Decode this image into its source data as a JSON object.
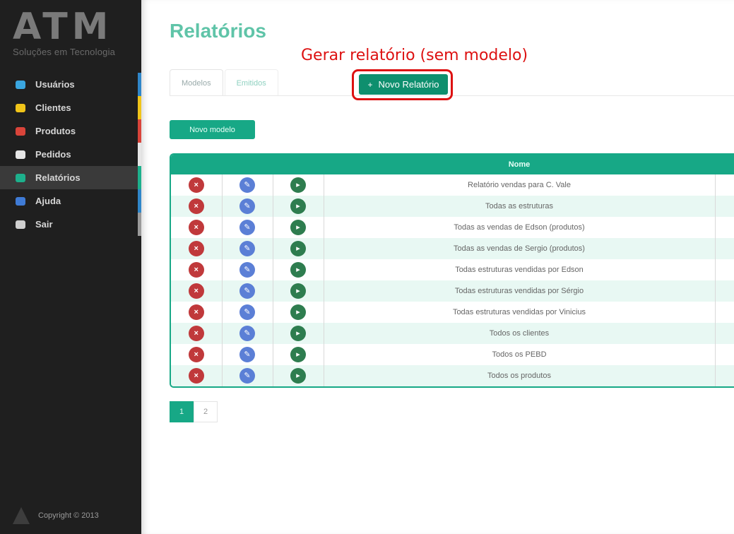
{
  "sidebar": {
    "logo": {
      "mark": "ATM",
      "subtitle": "Soluções em Tecnologia"
    },
    "items": [
      {
        "label": "Usuários",
        "icon": "users-icon",
        "icon_color": "#3aa6e0",
        "accent": "#2f86c9"
      },
      {
        "label": "Clientes",
        "icon": "clients-icon",
        "icon_color": "#f0c419",
        "accent": "#f0c419"
      },
      {
        "label": "Produtos",
        "icon": "products-icon",
        "icon_color": "#d9443a",
        "accent": "#d9443a"
      },
      {
        "label": "Pedidos",
        "icon": "orders-icon",
        "icon_color": "#e6e6e6",
        "accent": "#e6e6e6"
      },
      {
        "label": "Relatórios",
        "icon": "reports-icon",
        "icon_color": "#1db08c",
        "accent": "#1db08c"
      },
      {
        "label": "Ajuda",
        "icon": "help-icon",
        "icon_color": "#3f7bd6",
        "accent": "#2f86c9"
      },
      {
        "label": "Sair",
        "icon": "exit-icon",
        "icon_color": "#cfcfcf",
        "accent": "#9a9a9a"
      }
    ],
    "copyright": "Copyright © 2013"
  },
  "main": {
    "title": "Relatórios",
    "annotation": "Gerar relatório (sem modelo)",
    "tabs": [
      {
        "label": "Modelos"
      },
      {
        "label": "Emitidos"
      }
    ],
    "new_report_label": "Novo Relatório",
    "new_model_label": "Novo modelo",
    "table": {
      "header": "Nome",
      "rows": [
        "Relatório vendas para C. Vale",
        "Todas as estruturas",
        "Todas as vendas de Edson (produtos)",
        "Todas as vendas de Sergio (produtos)",
        "Todas estruturas vendidas por Edson",
        "Todas estruturas vendidas por Sérgio",
        "Todas estruturas vendidas por Vinicius",
        "Todos os clientes",
        "Todos os PEBD",
        "Todos os produtos"
      ]
    },
    "pagination": {
      "pages": [
        "1",
        "2"
      ],
      "current": "1"
    }
  },
  "colors": {
    "brand": "#17a886",
    "button_dark": "#0e8f6e",
    "annotation": "#dd1111",
    "delete": "#c0393b",
    "edit": "#5b7fd6",
    "generate": "#2e7d4f"
  }
}
